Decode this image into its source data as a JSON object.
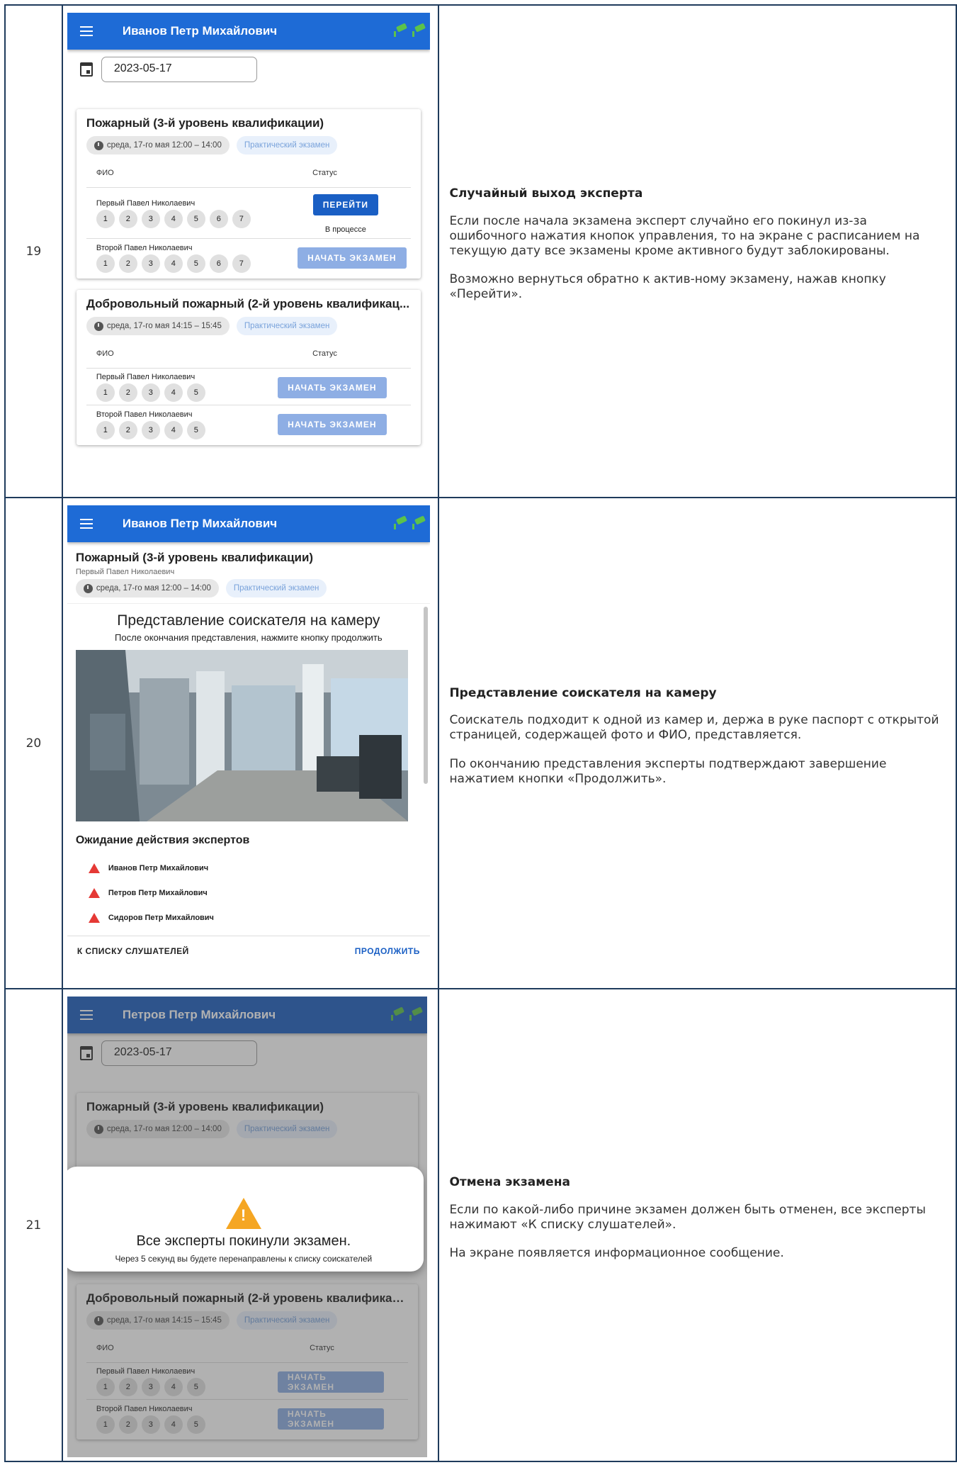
{
  "rows": [
    {
      "num": "19",
      "desc": {
        "title": "Случайный выход эксперта",
        "p1": "Если после начала экзамена эксперт случайно его покинул из-за ошибочного нажатия кнопок управления, то на экране с расписанием на текущую дату все экзамены кроме активного будут заблокированы.",
        "p2": "Возможно вернуться обратно к актив-ному экзамену, нажав кнопку «Перейти»."
      },
      "screen": {
        "user": "Иванов Петр Михайлович",
        "date": "2023-05-17",
        "cards": [
          {
            "title": "Пожарный (3-й уровень квалификации)",
            "time": "среда, 17-го мая 12:00 – 14:00",
            "type": "Практический экзамен",
            "col_name": "ФИО",
            "col_status": "Статус",
            "people": [
              {
                "name": "Первый Павел Николаевич",
                "nums": [
                  "1",
                  "2",
                  "3",
                  "4",
                  "5",
                  "6",
                  "7"
                ],
                "button": "ПЕРЕЙТИ",
                "status": "В процессе"
              },
              {
                "name": "Второй Павел Николаевич",
                "nums": [
                  "1",
                  "2",
                  "3",
                  "4",
                  "5",
                  "6",
                  "7"
                ],
                "button": "НАЧАТЬ ЭКЗАМЕН"
              }
            ]
          },
          {
            "title": "Добровольный пожарный (2-й уровень квалификац...",
            "time": "среда, 17-го мая 14:15 – 15:45",
            "type": "Практический экзамен",
            "col_name": "ФИО",
            "col_status": "Статус",
            "people": [
              {
                "name": "Первый Павел Николаевич",
                "nums": [
                  "1",
                  "2",
                  "3",
                  "4",
                  "5"
                ],
                "button": "НАЧАТЬ ЭКЗАМЕН"
              },
              {
                "name": "Второй Павел Николаевич",
                "nums": [
                  "1",
                  "2",
                  "3",
                  "4",
                  "5"
                ],
                "button": "НАЧАТЬ ЭКЗАМЕН"
              }
            ]
          }
        ]
      }
    },
    {
      "num": "20",
      "desc": {
        "title": "Представление соискателя на камеру",
        "p1": "Соискатель подходит к одной из камер и, держа в руке паспорт с открытой страницей, содержащей фото и ФИО, представляется.",
        "p2": "По окончанию представления эксперты подтверждают завершение нажатием кнопки «Продолжить»."
      },
      "screen": {
        "user": "Иванов Петр Михайлович",
        "exam_title": "Пожарный (3-й уровень квалификации)",
        "candidate": "Первый Павел Николаевич",
        "time": "среда, 17-го мая 12:00 – 14:00",
        "type": "Практический экзамен",
        "panel_title": "Представление соискателя на камеру",
        "panel_sub": "После окончания представления, нажмите кнопку продолжить",
        "wait_title": "Ожидание действия экспертов",
        "experts": [
          "Иванов Петр Михайлович",
          "Петров Петр Михайлович",
          "Сидоров Петр Михайлович"
        ],
        "back": "К СПИСКУ СЛУШАТЕЛЕЙ",
        "continue": "ПРОДОЛЖИТЬ"
      }
    },
    {
      "num": "21",
      "desc": {
        "title": "Отмена экзамена",
        "p1": "Если по какой-либо причине экзамен должен быть отменен, все эксперты нажимают «К списку слушателей».",
        "p2": "На экране появляется информационное сообщение."
      },
      "screen": {
        "user": "Петров Петр Михайлович",
        "date": "2023-05-17",
        "card1_title": "Пожарный (3-й уровень квалификации)",
        "card1_time": "среда, 17-го мая 12:00 – 14:00",
        "card1_type": "Практический экзамен",
        "dialog_title": "Все эксперты покинули экзамен.",
        "dialog_sub": "Через 5 секунд вы будете перенаправлены к списку соискателей",
        "card2_title": "Добровольный пожарный (2-й уровень квалификац...",
        "card2_time": "среда, 17-го мая 14:15 – 15:45",
        "card2_type": "Практический экзамен",
        "col_name": "ФИО",
        "col_status": "Статус",
        "people": [
          {
            "name": "Первый Павел Николаевич",
            "nums": [
              "1",
              "2",
              "3",
              "4",
              "5"
            ],
            "button": "НАЧАТЬ ЭКЗАМЕН"
          },
          {
            "name": "Второй Павел Николаевич",
            "nums": [
              "1",
              "2",
              "3",
              "4",
              "5"
            ],
            "button": "НАЧАТЬ ЭКЗАМЕН"
          }
        ]
      }
    }
  ]
}
